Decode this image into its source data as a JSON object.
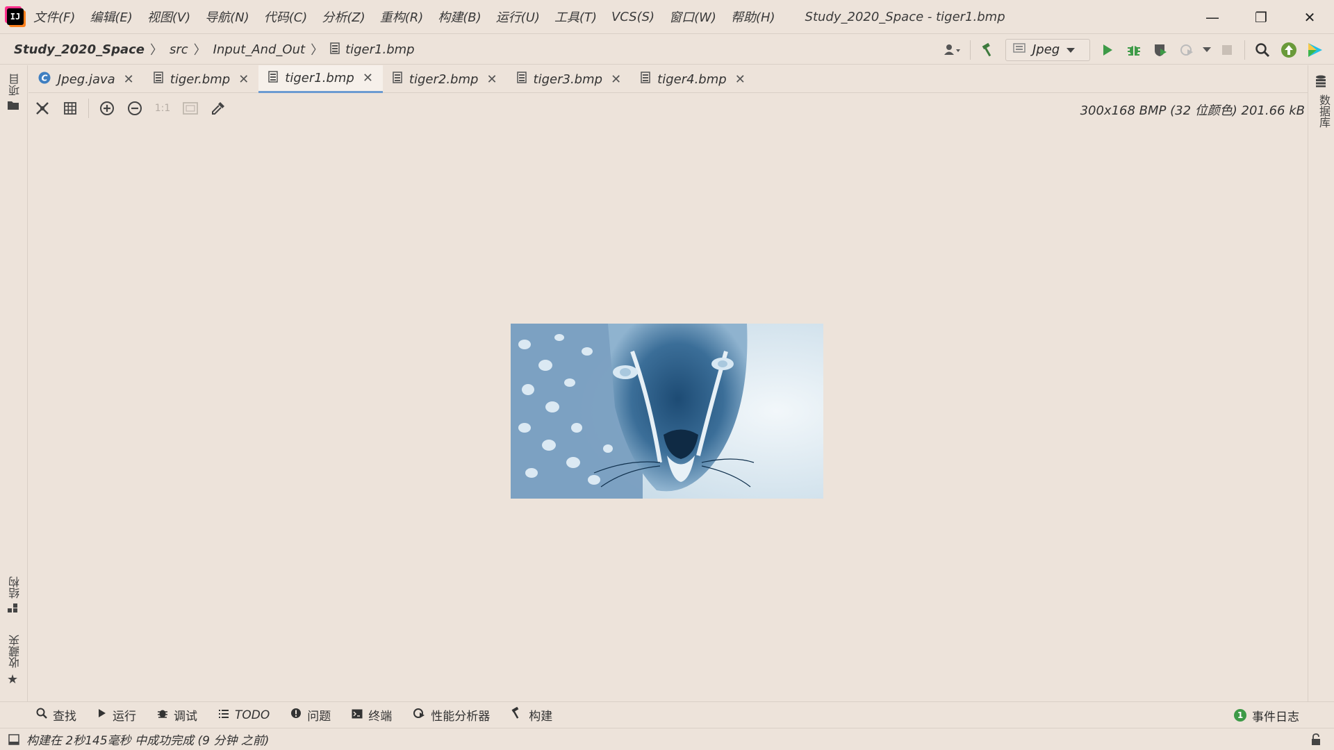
{
  "app": {
    "logo_text": "IJ"
  },
  "menu": {
    "items": [
      "文件(F)",
      "编辑(E)",
      "视图(V)",
      "导航(N)",
      "代码(C)",
      "分析(Z)",
      "重构(R)",
      "构建(B)",
      "运行(U)",
      "工具(T)",
      "VCS(S)",
      "窗口(W)",
      "帮助(H)"
    ]
  },
  "window": {
    "title": "Study_2020_Space - tiger1.bmp",
    "minimize": "—",
    "restore": "❐",
    "close": "✕"
  },
  "breadcrumb": {
    "items": [
      "Study_2020_Space",
      "src",
      "Input_And_Out",
      "tiger1.bmp"
    ],
    "separator": "〉"
  },
  "run_config": {
    "label": "Jpeg"
  },
  "tabs": [
    {
      "label": "Jpeg.java",
      "icon": "java-class-icon",
      "active": false
    },
    {
      "label": "tiger.bmp",
      "icon": "image-file-icon",
      "active": false
    },
    {
      "label": "tiger1.bmp",
      "icon": "image-file-icon",
      "active": true
    },
    {
      "label": "tiger2.bmp",
      "icon": "image-file-icon",
      "active": false
    },
    {
      "label": "tiger3.bmp",
      "icon": "image-file-icon",
      "active": false
    },
    {
      "label": "tiger4.bmp",
      "icon": "image-file-icon",
      "active": false
    }
  ],
  "image_toolbar": {
    "actual_size_label": "1:1",
    "info": "300x168 BMP (32 位颜色) 201.66 kB"
  },
  "left_stripe": {
    "project": "项目",
    "structure": "结构",
    "favorites": "收藏夹"
  },
  "right_stripe": {
    "database": "数据库"
  },
  "tool_windows": [
    {
      "label": "查找",
      "icon": "search-icon"
    },
    {
      "label": "运行",
      "icon": "run-icon"
    },
    {
      "label": "调试",
      "icon": "debug-icon"
    },
    {
      "label": "TODO",
      "icon": "todo-icon"
    },
    {
      "label": "问题",
      "icon": "problems-icon"
    },
    {
      "label": "终端",
      "icon": "terminal-icon"
    },
    {
      "label": "性能分析器",
      "icon": "profiler-icon"
    },
    {
      "label": "构建",
      "icon": "build-icon"
    }
  ],
  "event_log": {
    "label": "事件日志",
    "count": "1"
  },
  "status": {
    "text": "构建在 2秒145毫秒 中成功完成 (9 分钟 之前)"
  },
  "colors": {
    "background": "#ede3da",
    "run_green": "#3d9a47",
    "active_tab_underline": "#6b9bd1",
    "vcs_update": "#6a9a3a"
  }
}
